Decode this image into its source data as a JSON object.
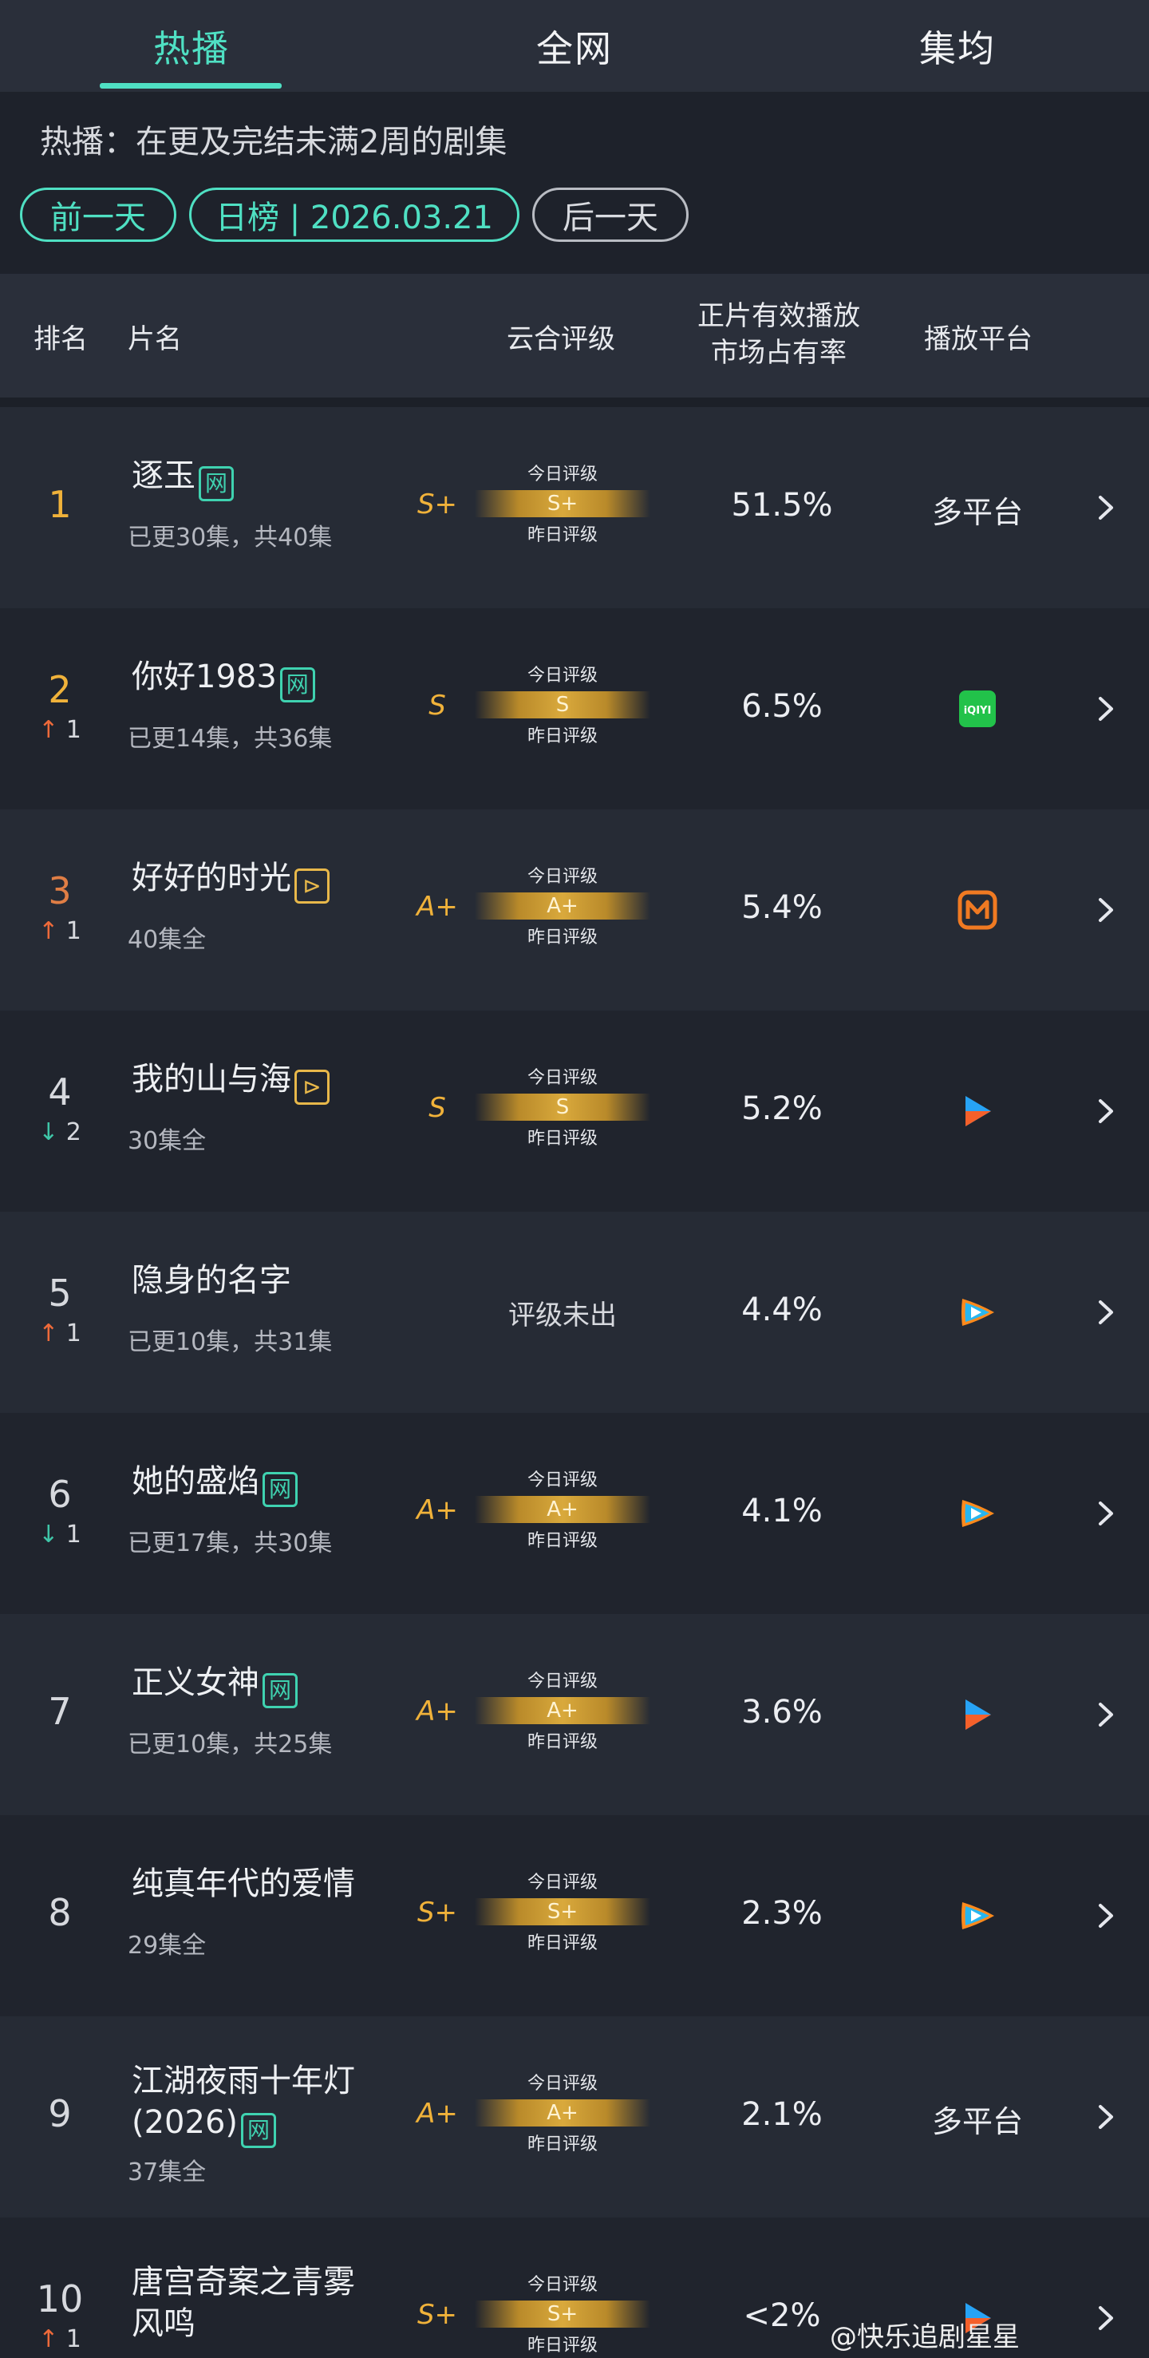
{
  "tabs": [
    {
      "label": "热播",
      "active": true
    },
    {
      "label": "全网",
      "active": false
    },
    {
      "label": "集均",
      "active": false
    }
  ],
  "description": "热播：在更及完结未满2周的剧集",
  "buttons": {
    "prev_day": "前一天",
    "daily_chart": "日榜 | 2026.03.21",
    "next_day": "后一天"
  },
  "header": {
    "rank": "排名",
    "title": "片名",
    "rating": "云合评级",
    "share_line1": "正片有效播放",
    "share_line2": "市场占有率",
    "platform": "播放平台"
  },
  "labels": {
    "today_rating": "今日评级",
    "yesterday_rating": "昨日评级",
    "no_rating": "评级未出"
  },
  "rows": [
    {
      "rank": "1",
      "change_dir": "",
      "change": "",
      "title": "逐玉",
      "badge": "网",
      "badge_type": "wang",
      "episodes": "已更30集，共40集",
      "rating": "S+",
      "share": "51.5%",
      "platform": "多平台",
      "platform_icon": ""
    },
    {
      "rank": "2",
      "change_dir": "up",
      "change": "1",
      "title": "你好1983",
      "badge": "网",
      "badge_type": "wang",
      "episodes": "已更14集，共36集",
      "rating": "S",
      "share": "6.5%",
      "platform": "",
      "platform_icon": "iqiyi-icon"
    },
    {
      "rank": "3",
      "change_dir": "up",
      "change": "1",
      "title": "好好的时光",
      "badge": "⊳",
      "badge_type": "tx",
      "episodes": "40集全",
      "rating": "A+",
      "share": "5.4%",
      "platform": "",
      "platform_icon": "mango-tv-icon"
    },
    {
      "rank": "4",
      "change_dir": "down",
      "change": "2",
      "title": "我的山与海",
      "badge": "⊳",
      "badge_type": "tx",
      "episodes": "30集全",
      "rating": "S",
      "share": "5.2%",
      "platform": "",
      "platform_icon": "youku-icon"
    },
    {
      "rank": "5",
      "change_dir": "up",
      "change": "1",
      "title": "隐身的名字",
      "badge": "",
      "badge_type": "",
      "episodes": "已更10集，共31集",
      "rating": "",
      "share": "4.4%",
      "platform": "",
      "platform_icon": "tencent-video-icon"
    },
    {
      "rank": "6",
      "change_dir": "down",
      "change": "1",
      "title": "她的盛焰",
      "badge": "网",
      "badge_type": "wang",
      "episodes": "已更17集，共30集",
      "rating": "A+",
      "share": "4.1%",
      "platform": "",
      "platform_icon": "tencent-video-icon"
    },
    {
      "rank": "7",
      "change_dir": "",
      "change": "",
      "title": "正义女神",
      "badge": "网",
      "badge_type": "wang",
      "episodes": "已更10集，共25集",
      "rating": "A+",
      "share": "3.6%",
      "platform": "",
      "platform_icon": "youku-icon"
    },
    {
      "rank": "8",
      "change_dir": "",
      "change": "",
      "title": "纯真年代的爱情",
      "badge": "",
      "badge_type": "",
      "episodes": "29集全",
      "rating": "S+",
      "share": "2.3%",
      "platform": "",
      "platform_icon": "tencent-video-icon"
    },
    {
      "rank": "9",
      "change_dir": "",
      "change": "",
      "title": "江湖夜雨十年灯",
      "title2": "(2026)",
      "badge": "网",
      "badge_type": "wang",
      "episodes": "37集全",
      "rating": "A+",
      "share": "2.1%",
      "platform": "多平台",
      "platform_icon": ""
    },
    {
      "rank": "10",
      "change_dir": "up",
      "change": "1",
      "title": "唐宫奇案之青雾",
      "title2": "风鸣",
      "badge": "",
      "badge_type": "",
      "episodes": "",
      "rating": "S+",
      "share": "<2%",
      "platform": "",
      "platform_icon": "youku-icon"
    }
  ],
  "watermark": "@快乐追剧星星",
  "colors": {
    "accent": "#4fe0c3",
    "gold": "#f0b23a",
    "up": "#ee6a3a",
    "down": "#3fc6a8"
  }
}
